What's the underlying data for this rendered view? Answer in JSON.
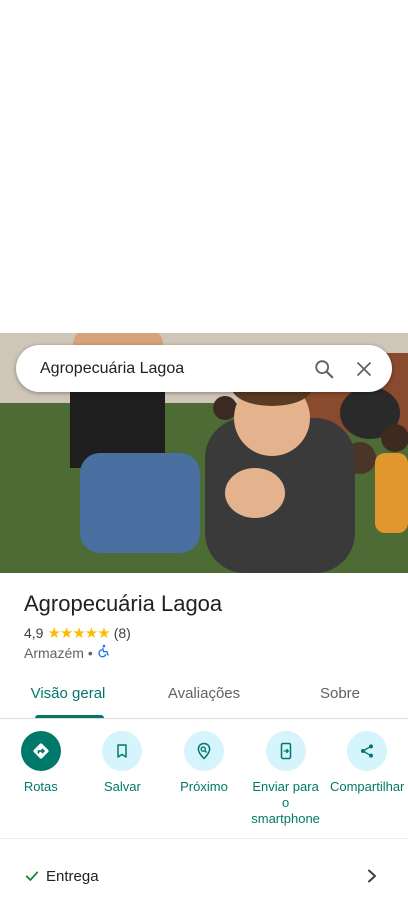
{
  "search": {
    "query": "Agropecuária Lagoa"
  },
  "place": {
    "name": "Agropecuária Lagoa",
    "rating": "4,9",
    "stars": "★★★★★",
    "review_count": "(8)",
    "category": "Armazém",
    "separator": "•"
  },
  "tabs": [
    {
      "label": "Visão geral"
    },
    {
      "label": "Avaliações"
    },
    {
      "label": "Sobre"
    }
  ],
  "actions": [
    {
      "label": "Rotas",
      "icon": "directions-icon"
    },
    {
      "label": "Salvar",
      "icon": "bookmark-icon"
    },
    {
      "label": "Próximo",
      "icon": "nearby-icon"
    },
    {
      "label": "Enviar para o smartphone",
      "icon": "send-to-phone-icon"
    },
    {
      "label": "Compartilhar",
      "icon": "share-icon"
    }
  ],
  "attributes": [
    {
      "label": "Entrega"
    }
  ],
  "colors": {
    "accent": "#00796b",
    "action_bg": "#d5f4fb",
    "star": "#fbbc04"
  }
}
